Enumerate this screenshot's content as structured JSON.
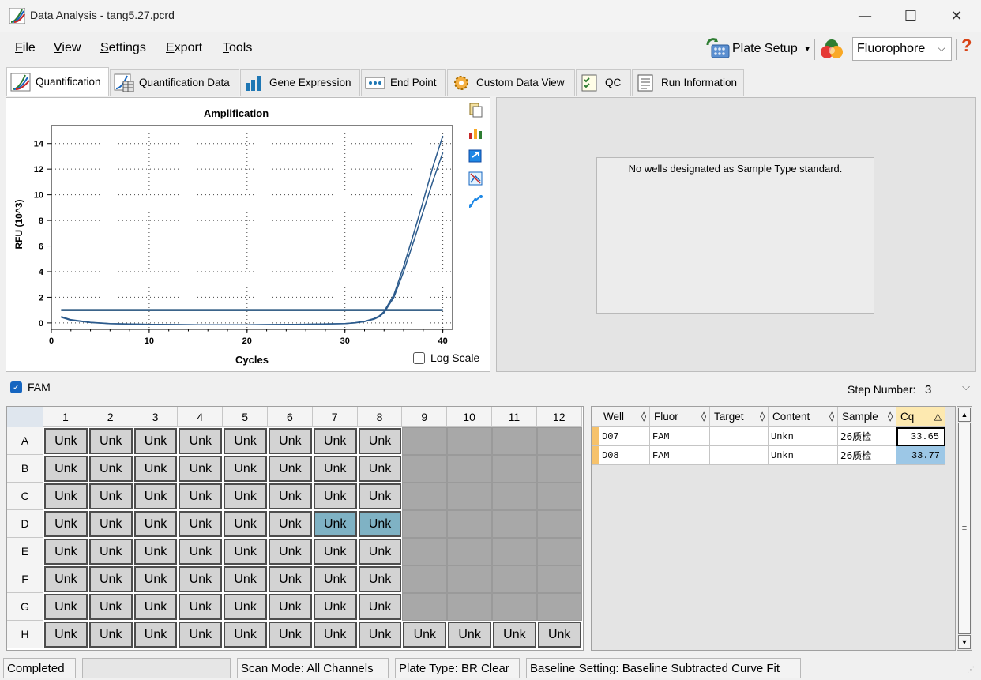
{
  "window": {
    "title": "Data Analysis - tang5.27.pcrd",
    "minimize": "—",
    "maximize": "☐",
    "close": "✕"
  },
  "menu": [
    "File",
    "View",
    "Settings",
    "Export",
    "Tools"
  ],
  "toolbar": {
    "plate_setup": "Plate Setup",
    "fluorophore": "Fluorophore",
    "help": "?"
  },
  "tabs": [
    "Quantification",
    "Quantification Data",
    "Gene Expression",
    "End Point",
    "Custom Data View",
    "QC",
    "Run Information"
  ],
  "standard_panel": {
    "message": "No wells designated as Sample Type standard."
  },
  "fluor_filter": {
    "label": "FAM",
    "checked": true
  },
  "step": {
    "label": "Step Number:",
    "value": "3"
  },
  "log_scale": {
    "label": "Log Scale",
    "checked": false
  },
  "plate": {
    "columns": [
      "1",
      "2",
      "3",
      "4",
      "5",
      "6",
      "7",
      "8",
      "9",
      "10",
      "11",
      "12"
    ],
    "rows": [
      "A",
      "B",
      "C",
      "D",
      "E",
      "F",
      "G",
      "H"
    ],
    "well_label": "Unk",
    "filled": {
      "A": [
        1,
        2,
        3,
        4,
        5,
        6,
        7,
        8
      ],
      "B": [
        1,
        2,
        3,
        4,
        5,
        6,
        7,
        8
      ],
      "C": [
        1,
        2,
        3,
        4,
        5,
        6,
        7,
        8
      ],
      "D": [
        1,
        2,
        3,
        4,
        5,
        6,
        7,
        8
      ],
      "E": [
        1,
        2,
        3,
        4,
        5,
        6,
        7,
        8
      ],
      "F": [
        1,
        2,
        3,
        4,
        5,
        6,
        7,
        8
      ],
      "G": [
        1,
        2,
        3,
        4,
        5,
        6,
        7,
        8
      ],
      "H": [
        1,
        2,
        3,
        4,
        5,
        6,
        7,
        8,
        9,
        10,
        11,
        12
      ]
    },
    "selected": [
      "D7",
      "D8"
    ]
  },
  "table": {
    "headers": [
      "Well",
      "Fluor",
      "Target",
      "Content",
      "Sample",
      "Cq"
    ],
    "rows": [
      {
        "well": "D07",
        "fluor": "FAM",
        "target": "",
        "content": "Unkn",
        "sample": "26质检",
        "cq": "33.65"
      },
      {
        "well": "D08",
        "fluor": "FAM",
        "target": "",
        "content": "Unkn",
        "sample": "26质检",
        "cq": "33.77"
      }
    ]
  },
  "status": {
    "state": "Completed",
    "progress": "",
    "scan_mode": "Scan Mode: All Channels",
    "plate_type": "Plate Type: BR Clear",
    "baseline": "Baseline Setting: Baseline Subtracted Curve Fit"
  },
  "colors": {
    "curve": "#2b5a8c",
    "threshold": "#1f4e79",
    "selected_well": "#7fb2c4",
    "empty_well": "#a8a8a8",
    "cq_selected": "#9cc7e6"
  },
  "chart_data": {
    "type": "line",
    "title": "Amplification",
    "xlabel": "Cycles",
    "ylabel": "RFU (10^3)",
    "xlim": [
      0,
      41
    ],
    "ylim": [
      -0.5,
      15.4
    ],
    "xticks": [
      0,
      10,
      20,
      30,
      40
    ],
    "yticks": [
      0,
      2,
      4,
      6,
      8,
      10,
      12,
      14
    ],
    "grid": true,
    "series": [
      {
        "x": [
          1,
          2,
          4,
          6,
          10,
          15,
          20,
          25,
          30,
          31,
          32,
          33,
          33.5,
          34,
          35,
          36,
          37,
          38,
          39,
          40
        ],
        "y": [
          0.5,
          0.25,
          0.05,
          -0.05,
          -0.12,
          -0.15,
          -0.15,
          -0.12,
          -0.05,
          0.02,
          0.12,
          0.35,
          0.55,
          0.9,
          2.2,
          4.4,
          6.9,
          9.5,
          12.2,
          14.6
        ]
      },
      {
        "x": [
          1,
          2,
          4,
          6,
          10,
          15,
          20,
          25,
          30,
          31,
          32,
          33,
          33.5,
          34,
          35,
          36,
          37,
          38,
          39,
          40
        ],
        "y": [
          0.45,
          0.2,
          0.03,
          -0.06,
          -0.12,
          -0.15,
          -0.15,
          -0.12,
          -0.05,
          0.0,
          0.1,
          0.3,
          0.48,
          0.8,
          2.0,
          4.0,
          6.3,
          8.7,
          11.1,
          13.3
        ]
      }
    ],
    "threshold": {
      "value": 1.0,
      "x": [
        1,
        40
      ]
    }
  }
}
